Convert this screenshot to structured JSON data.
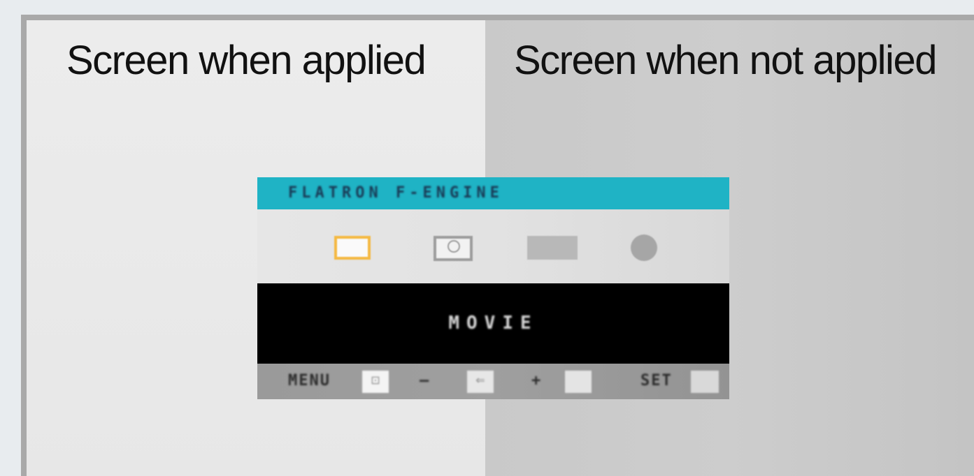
{
  "labels": {
    "left": "Screen when applied",
    "right": "Screen when not applied"
  },
  "osd": {
    "title": "FLATRON F-ENGINE",
    "icons": [
      "screen-icon",
      "monitor-icon",
      "bars-icon",
      "dot-icon"
    ],
    "body_text": "MOVIE",
    "footer": {
      "menu_label": "MENU",
      "menu_glyph": "⊡",
      "minus_label": "–",
      "minus_glyph": "⇐",
      "plus_label": "+",
      "plus_glyph": "",
      "set_label": "SET",
      "set_glyph": ""
    },
    "colors": {
      "title_bar": "#1fb3c5",
      "selected_icon_border": "#f5b942",
      "body_background": "#000000"
    }
  }
}
